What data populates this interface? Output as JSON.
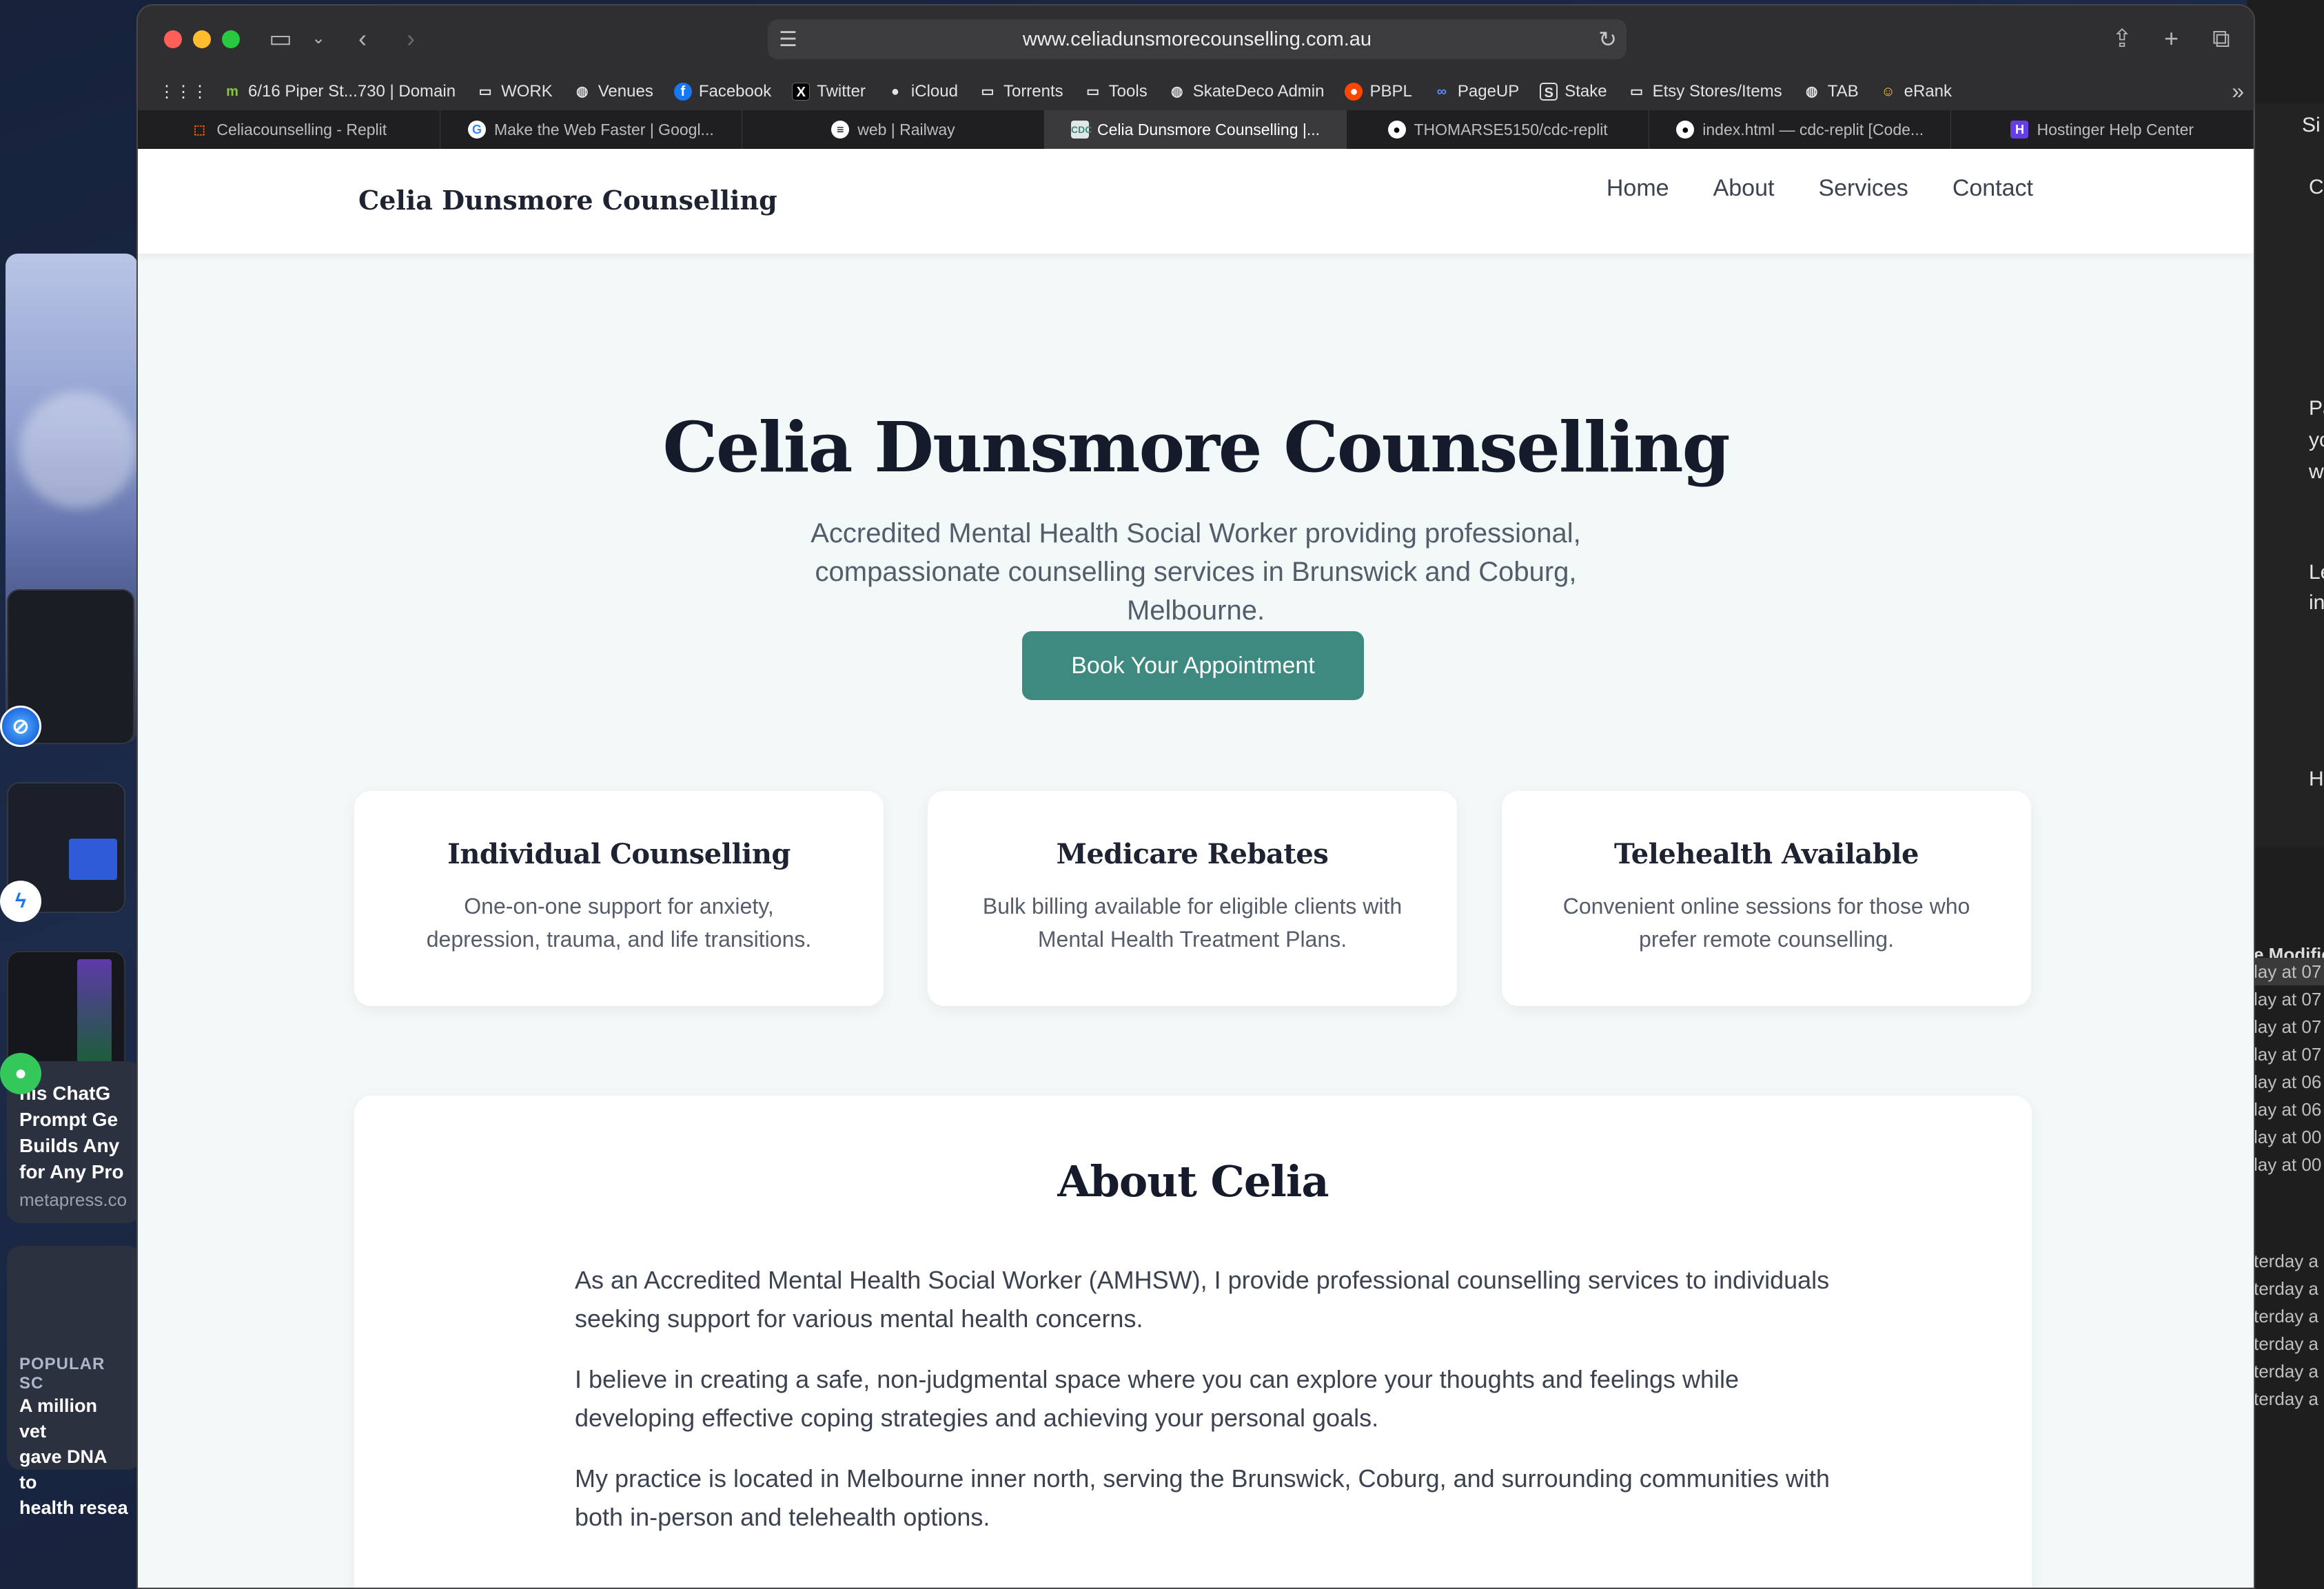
{
  "browser": {
    "url": "www.celiadunsmorecounselling.com.au",
    "bookmarks": [
      {
        "label": "6/16 Piper St...730 | Domain",
        "icon": "domain-icon"
      },
      {
        "label": "WORK",
        "icon": "folder-icon"
      },
      {
        "label": "Venues",
        "icon": "globe-icon"
      },
      {
        "label": "Facebook",
        "icon": "facebook-icon"
      },
      {
        "label": "Twitter",
        "icon": "x-icon"
      },
      {
        "label": "iCloud",
        "icon": "apple-icon"
      },
      {
        "label": "Torrents",
        "icon": "folder-icon"
      },
      {
        "label": "Tools",
        "icon": "folder-icon"
      },
      {
        "label": "SkateDeco Admin",
        "icon": "globe-icon"
      },
      {
        "label": "PBPL",
        "icon": "reddit-icon"
      },
      {
        "label": "PageUP",
        "icon": "pageup-icon"
      },
      {
        "label": "Stake",
        "icon": "stake-icon"
      },
      {
        "label": "Etsy Stores/Items",
        "icon": "folder-icon"
      },
      {
        "label": "TAB",
        "icon": "globe-icon"
      },
      {
        "label": "eRank",
        "icon": "smiley-icon"
      }
    ],
    "tabs": [
      {
        "label": "Celiacounselling - Replit",
        "icon": "replit-icon"
      },
      {
        "label": "Make the Web Faster  |  Googl...",
        "icon": "google-icon"
      },
      {
        "label": "web | Railway",
        "icon": "railway-icon"
      },
      {
        "label": "Celia Dunsmore Counselling |...",
        "icon": "cdc-icon",
        "active": true
      },
      {
        "label": "THOMARSE5150/cdc-replit",
        "icon": "github-icon"
      },
      {
        "label": "index.html — cdc-replit [Code...",
        "icon": "github-icon"
      },
      {
        "label": "Hostinger Help Center",
        "icon": "hostinger-icon"
      }
    ]
  },
  "site": {
    "logo": "Celia Dunsmore Counselling",
    "nav": [
      "Home",
      "About",
      "Services",
      "Contact"
    ],
    "hero": {
      "title": "Celia Dunsmore Counselling",
      "subtitle": "Accredited Mental Health Social Worker providing professional, compassionate counselling services in Brunswick and Coburg, Melbourne.",
      "cta": "Book Your Appointment"
    },
    "cards": [
      {
        "title": "Individual Counselling",
        "text": "One-on-one support for anxiety, depression, trauma, and life transitions."
      },
      {
        "title": "Medicare Rebates",
        "text": "Bulk billing available for eligible clients with Mental Health Treatment Plans."
      },
      {
        "title": "Telehealth Available",
        "text": "Convenient online sessions for those who prefer remote counselling."
      }
    ],
    "about": {
      "title": "About Celia",
      "paragraphs": [
        "As an Accredited Mental Health Social Worker (AMHSW), I provide professional counselling services to individuals seeking support for various mental health concerns.",
        "I believe in creating a safe, non-judgmental space where you can explore your thoughts and feelings while developing effective coping strategies and achieving your personal goals.",
        "My practice is located in Melbourne inner north, serving the Brunswick, Coburg, and surrounding communities with both in-person and telehealth options."
      ]
    }
  },
  "desktop": {
    "news1": {
      "headline": "nis ChatG\nPrompt Ge\nBuilds Any\nfor Any Pro",
      "source": "metapress.co"
    },
    "news2": {
      "tag": "POPULAR SC",
      "headline": "A million vet\ngave DNA to\nhealth resea"
    },
    "right_peek": [
      "Si",
      "C",
      "Pa",
      "yc",
      "w",
      "Le",
      "in",
      "He"
    ],
    "right_list_header": "e Modifie",
    "right_list_rows": [
      "lay at 07",
      "lay at 07",
      "lay at 07",
      "lay at 07",
      "lay at 06",
      "lay at 06",
      "lay at 00",
      "lay at 00",
      "terday a",
      "terday a",
      "terday a",
      "terday a",
      "terday a",
      "terday a"
    ]
  },
  "colors": {
    "accent": "#3e8a80",
    "page_bg": "#f3f8f8",
    "heading": "#161b2b"
  }
}
